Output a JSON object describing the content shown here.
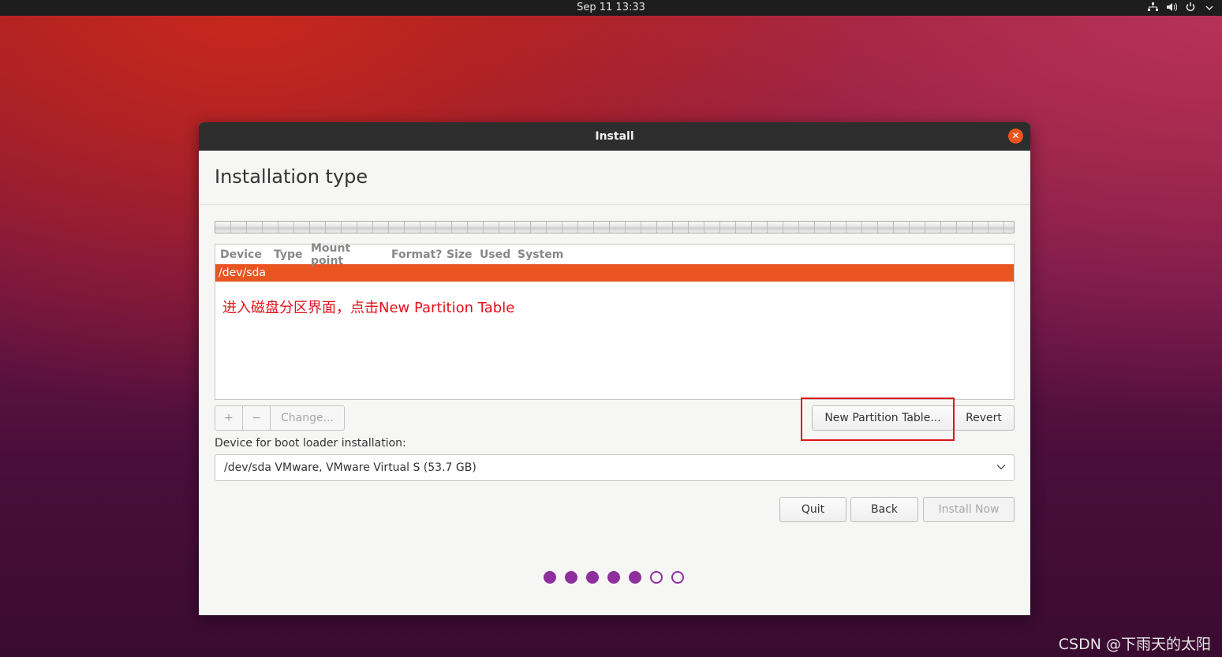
{
  "topbar": {
    "datetime": "Sep 11  13:33",
    "icons": [
      "network-icon",
      "volume-icon",
      "power-icon",
      "chevron-down-icon"
    ]
  },
  "window": {
    "title": "Install",
    "close_symbol": "✕"
  },
  "page": {
    "title": "Installation type"
  },
  "partition_table": {
    "columns": [
      "Device",
      "Type",
      "Mount point",
      "Format?",
      "Size",
      "Used",
      "System"
    ],
    "rows": [
      {
        "device": "/dev/sda",
        "selected": true
      }
    ]
  },
  "annotation": {
    "text": "进入磁盘分区界面，点击New Partition Table",
    "color": "#e5101a"
  },
  "tools": {
    "add_label": "+",
    "remove_label": "−",
    "change_label": "Change..."
  },
  "buttons": {
    "new_partition_table": "New Partition Table...",
    "revert": "Revert",
    "quit": "Quit",
    "back": "Back",
    "install_now": "Install Now"
  },
  "boot_loader": {
    "label": "Device for boot loader installation:",
    "selected": "/dev/sda VMware, VMware Virtual S (53.7 GB)"
  },
  "progress": {
    "total_steps": 7,
    "completed_steps": 5
  },
  "watermark": "CSDN @下雨天的太阳",
  "colors": {
    "accent": "#e95420",
    "progress": "#8e2f9d",
    "highlight": "#e0141a"
  }
}
